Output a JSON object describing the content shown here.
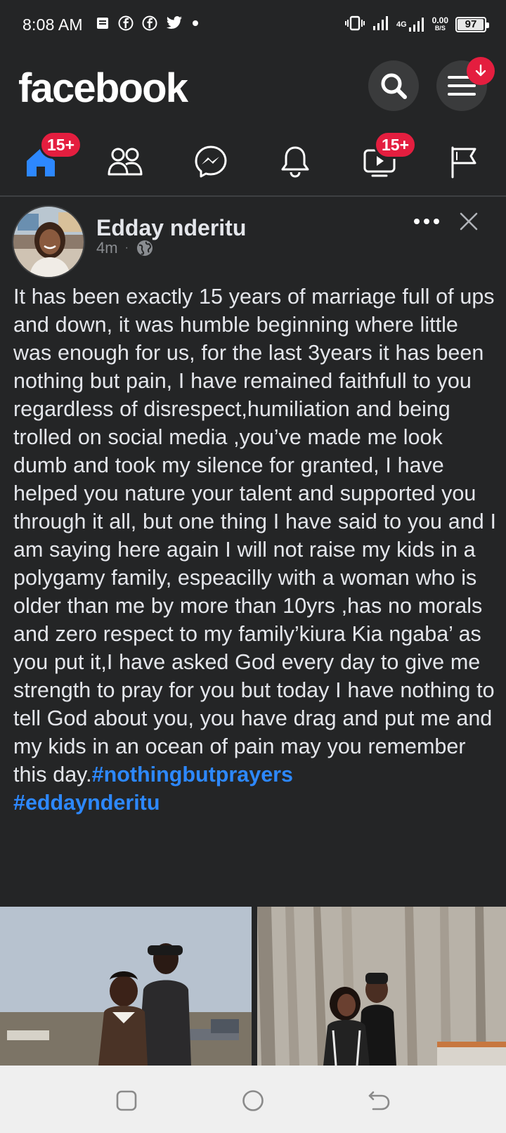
{
  "status_bar": {
    "time": "8:08 AM",
    "left_icons": [
      "message-icon",
      "facebook-icon",
      "facebook-icon",
      "twitter-icon",
      "dot-icon"
    ],
    "network_type": "4G",
    "net_speed_value": "0.00",
    "net_speed_unit": "B/S",
    "battery": "97",
    "battery_level": 0.97
  },
  "header": {
    "logo": "facebook",
    "update_badge_icon": "arrow-down-icon"
  },
  "tabs": {
    "home_badge": "15+",
    "watch_badge": "15+",
    "active_color": "#2d88ff"
  },
  "post": {
    "author": "Edday nderitu",
    "time": "4m",
    "separator": "·",
    "body": "It has been exactly 15 years of marriage full of ups and down, it was humble beginning where little was enough for us, for the last 3years it has been nothing but pain, I have remained faithfull to you regardless of disrespect,humiliation and being trolled on social media ,you’ve made me look dumb and took my silence for granted, I have helped you nature your talent and supported you through it all, but one thing I have said to you and I am saying here again I will not raise my kids in a polygamy family, espeacilly with a woman who is older than me by more than 10yrs ,has no morals and zero respect to my family’kiura Kia ngaba’  as you put it,I have asked God every day to give me strength to pray for you but today I have nothing to tell God about you, you have drag and put me and my kids in an ocean of pain may you remember this day.",
    "hashtag_1": "#nothingbutprayers",
    "hashtag_2": "#eddaynderitu"
  },
  "colors": {
    "background": "#242526",
    "badge_red": "#e41e3f",
    "link_blue": "#2d88ff",
    "nav_bar": "#efefef"
  }
}
